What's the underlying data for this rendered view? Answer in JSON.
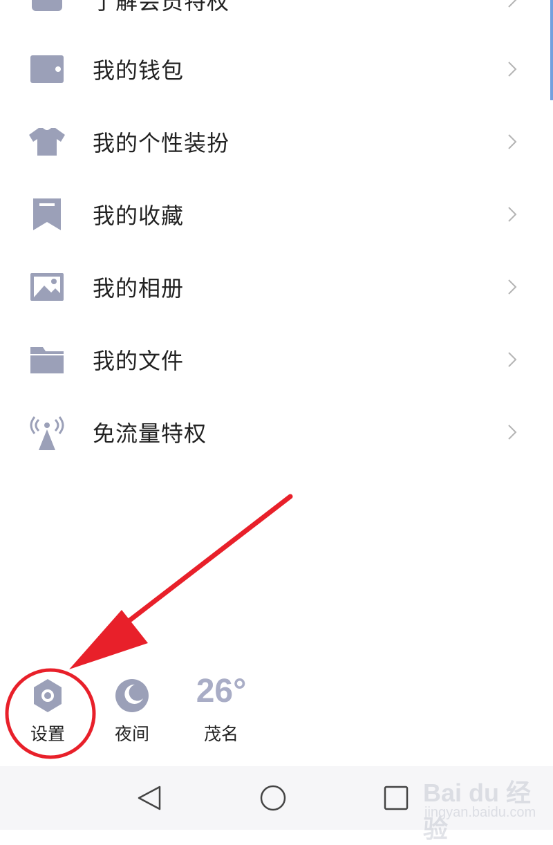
{
  "menu": {
    "items": [
      {
        "label": "了解会员特权",
        "icon": "crown-icon"
      },
      {
        "label": "我的钱包",
        "icon": "wallet-icon"
      },
      {
        "label": "我的个性装扮",
        "icon": "tshirt-icon"
      },
      {
        "label": "我的收藏",
        "icon": "bookmark-icon"
      },
      {
        "label": "我的相册",
        "icon": "image-icon"
      },
      {
        "label": "我的文件",
        "icon": "folder-icon"
      },
      {
        "label": "免流量特权",
        "icon": "signal-tower-icon"
      }
    ]
  },
  "bottom": {
    "settings_label": "设置",
    "night_label": "夜间",
    "weather_temp": "26°",
    "weather_city": "茂名"
  },
  "watermark": {
    "line1": "Bai du 经验",
    "line2": "jingyan.baidu.com"
  },
  "colors": {
    "icon": "#9ba0b8",
    "annotation": "#e8202a"
  }
}
